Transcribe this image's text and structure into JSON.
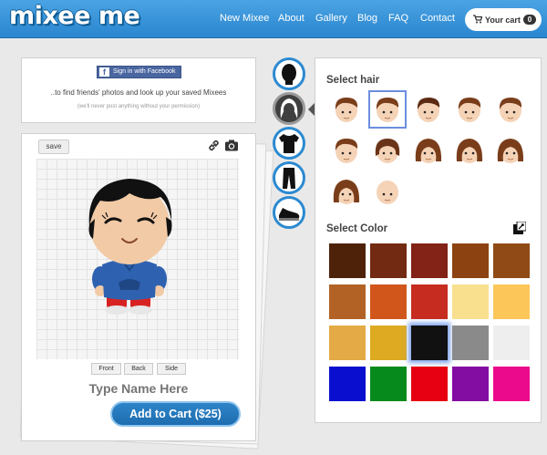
{
  "header": {
    "logo": "mixee me",
    "nav": [
      "New Mixee",
      "About",
      "Gallery",
      "Blog",
      "FAQ",
      "Contact"
    ],
    "cart_label": "Your cart",
    "cart_count": "0"
  },
  "login": {
    "fb_button": "Sign in with Facebook",
    "message": "..to find friends' photos and look up your saved Mixees",
    "note": "(we'll never post anything without your permission)"
  },
  "editor": {
    "save_label": "save",
    "views": [
      "Front",
      "Back",
      "Side"
    ],
    "name_placeholder": "Type Name Here",
    "add_to_cart": "Add to Cart ($25)"
  },
  "categories": [
    "skin-icon",
    "hair-icon",
    "shirt-icon",
    "pants-icon",
    "shoe-icon"
  ],
  "hair": {
    "title": "Select hair",
    "selected_index": 1,
    "options": [
      {
        "color": "#7a3d1a",
        "style": "short"
      },
      {
        "color": "#7a3d1a",
        "style": "side"
      },
      {
        "color": "#5c2a12",
        "style": "short"
      },
      {
        "color": "#7a3d1a",
        "style": "swoop"
      },
      {
        "color": "#7a3d1a",
        "style": "spiky"
      },
      {
        "color": "#7a3d1a",
        "style": "spiky"
      },
      {
        "color": "#6a3418",
        "style": "bob"
      },
      {
        "color": "#7a3d1a",
        "style": "long"
      },
      {
        "color": "#7a3d1a",
        "style": "long"
      },
      {
        "color": "#7a3d1a",
        "style": "long"
      },
      {
        "color": "#7a3d1a",
        "style": "ponytail"
      },
      {
        "color": "#f5d7bd",
        "style": "bald"
      }
    ]
  },
  "colors": {
    "title": "Select Color",
    "selected_index": 12,
    "swatches": [
      "#4e2208",
      "#732a12",
      "#832216",
      "#8d4212",
      "#8f4a16",
      "#b26225",
      "#d1561b",
      "#c62c1f",
      "#f8e08e",
      "#fdc659",
      "#e4aa45",
      "#ddaa22",
      "#111111",
      "#8a8a8a",
      "#eeeeee",
      "#0a0fcf",
      "#078a1c",
      "#e60011",
      "#830ca3",
      "#ec0a8c"
    ]
  }
}
